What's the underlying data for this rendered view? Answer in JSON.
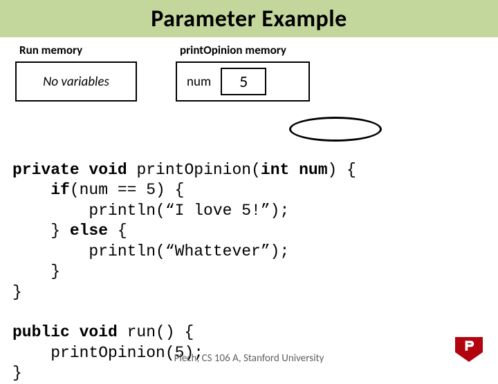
{
  "title": "Parameter Example",
  "memory": {
    "left": {
      "heading": "Run memory",
      "content": "No variables"
    },
    "right": {
      "heading": "printOpinion memory",
      "var_name": "num",
      "var_value": "5"
    }
  },
  "code": {
    "l1a": "private void",
    "l1b": " print",
    "l1c": "Opinion(",
    "l1d": "int num",
    "l1e": ") {",
    "l2a": "    if",
    "l2b": "(num == 5) {",
    "l3": "        println(“I love 5!”);",
    "l4a": "    } ",
    "l4b": "else",
    "l4c": " {",
    "l5": "        println(“Whattever”);",
    "l6": "    }",
    "l7": "}",
    "l8": "",
    "l9a": "public void",
    "l9b": " run() {",
    "l10a": "    print",
    "l10b": "Opinion(5);",
    "l11": "}"
  },
  "footer": "Piech, CS 106 A, Stanford University"
}
